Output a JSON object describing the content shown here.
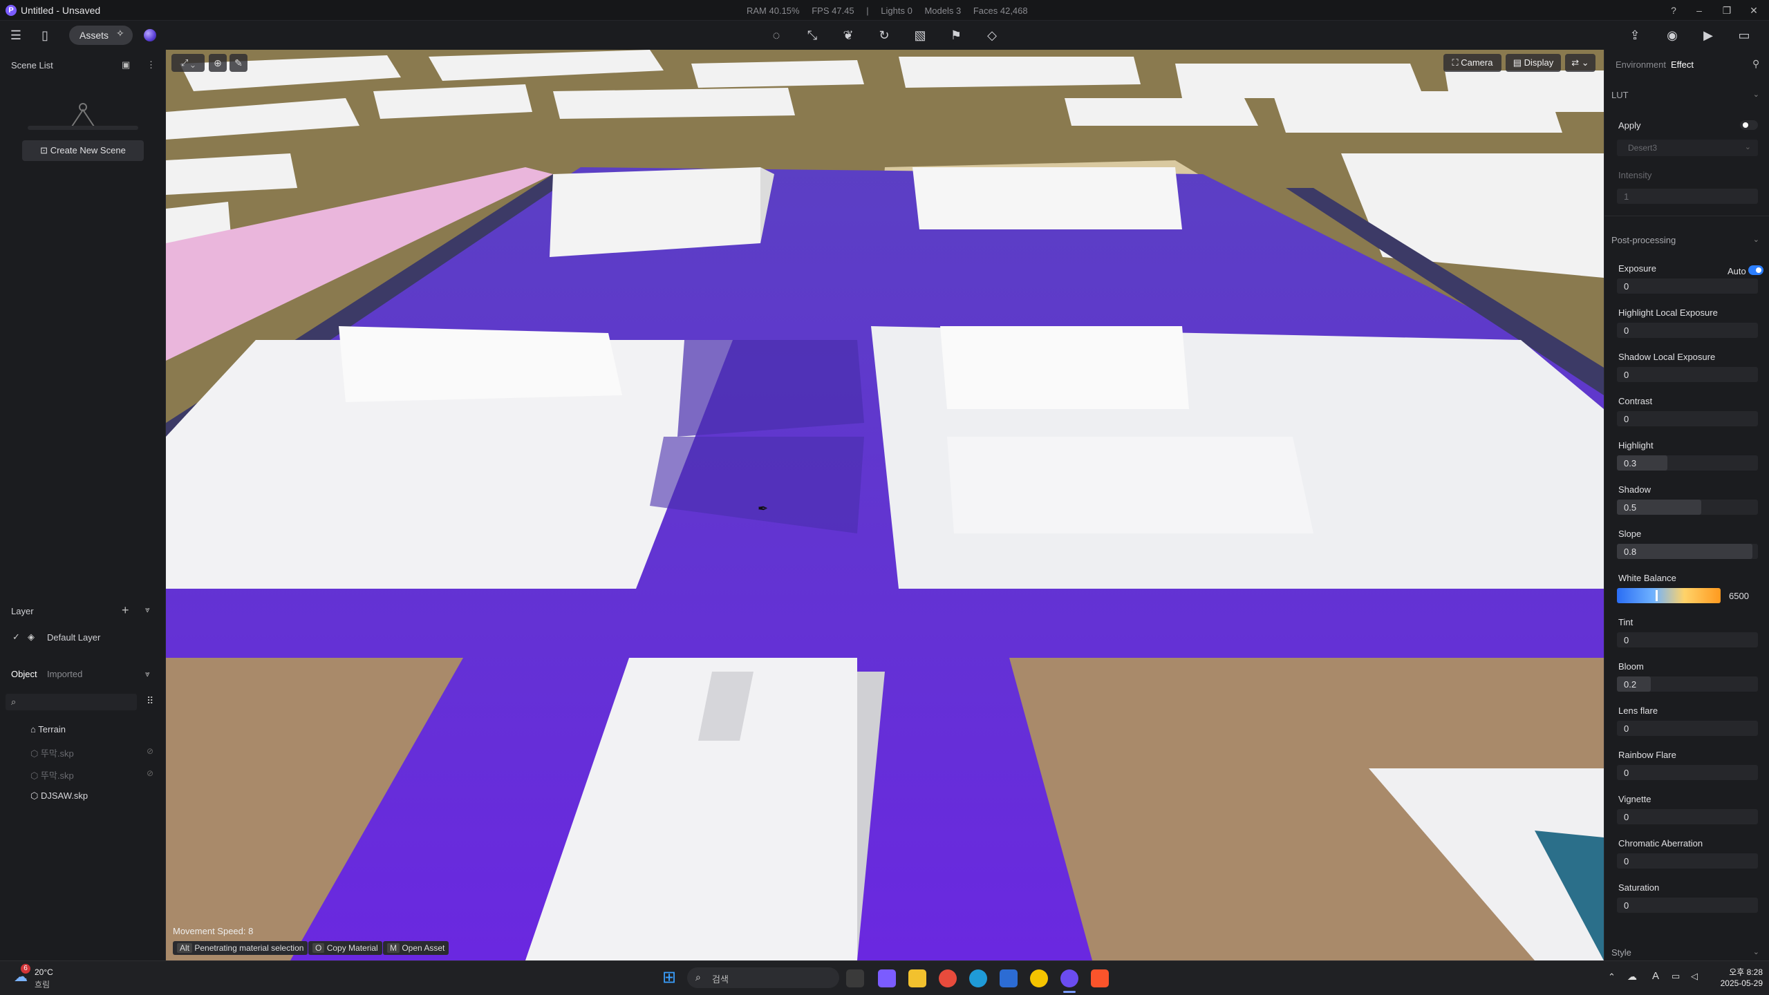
{
  "window": {
    "title": "Untitled - Unsaved",
    "stats": [
      "RAM 40.15%",
      "FPS 47.45",
      "|",
      "Lights 0",
      "Models 3",
      "Faces 42,468"
    ]
  },
  "toolbar": {
    "assets_label": "Assets"
  },
  "left_panel": {
    "scene_list_title": "Scene List",
    "create_scene_label": "Create New Scene",
    "layer_title": "Layer",
    "default_layer": "Default Layer",
    "tab_object": "Object",
    "tab_imported": "Imported",
    "objects": [
      {
        "name": "Terrain",
        "dim": false
      },
      {
        "name": "뚜막.skp",
        "dim": true
      },
      {
        "name": "뚜막.skp",
        "dim": true
      },
      {
        "name": "DJSAW.skp",
        "dim": false
      }
    ]
  },
  "viewport": {
    "camera_label": "Camera",
    "display_label": "Display",
    "movement_speed": "Movement Speed: 8",
    "hints": [
      {
        "key": "Alt",
        "label": "Penetrating material selection"
      },
      {
        "key": "O",
        "label": "Copy Material"
      },
      {
        "key": "M",
        "label": "Open Asset"
      }
    ]
  },
  "right_panel": {
    "tab_environment": "Environment",
    "tab_effect": "Effect",
    "lut_title": "LUT",
    "apply_label": "Apply",
    "lut_select": "Desert3",
    "intensity_label": "Intensity",
    "intensity_value": "1",
    "post_title": "Post-processing",
    "auto_label": "Auto",
    "fields": [
      {
        "label": "Exposure",
        "value": "0",
        "fill": 0
      },
      {
        "label": "Highlight Local Exposure",
        "value": "0",
        "fill": 0
      },
      {
        "label": "Shadow Local Exposure",
        "value": "0",
        "fill": 0
      },
      {
        "label": "Contrast",
        "value": "0",
        "fill": 0
      },
      {
        "label": "Highlight",
        "value": "0.3",
        "fill": 0.18
      },
      {
        "label": "Shadow",
        "value": "0.5",
        "fill": 0.3
      },
      {
        "label": "Slope",
        "value": "0.8",
        "fill": 0.48
      },
      {
        "label": "White Balance",
        "value": "6500",
        "fill": 0
      },
      {
        "label": "Tint",
        "value": "0",
        "fill": 0
      },
      {
        "label": "Bloom",
        "value": "0.2",
        "fill": 0.12
      },
      {
        "label": "Lens flare",
        "value": "0",
        "fill": 0
      },
      {
        "label": "Rainbow Flare",
        "value": "0",
        "fill": 0
      },
      {
        "label": "Vignette",
        "value": "0",
        "fill": 0
      },
      {
        "label": "Chromatic Aberration",
        "value": "0",
        "fill": 0
      },
      {
        "label": "Saturation",
        "value": "0",
        "fill": 0
      }
    ],
    "style_title": "Style"
  },
  "taskbar": {
    "weather_temp": "20°C",
    "weather_desc": "흐림",
    "weather_badge": "6",
    "search_placeholder": "검색",
    "ime": "A",
    "time": "오후 8:28",
    "date": "2025-05-29"
  }
}
